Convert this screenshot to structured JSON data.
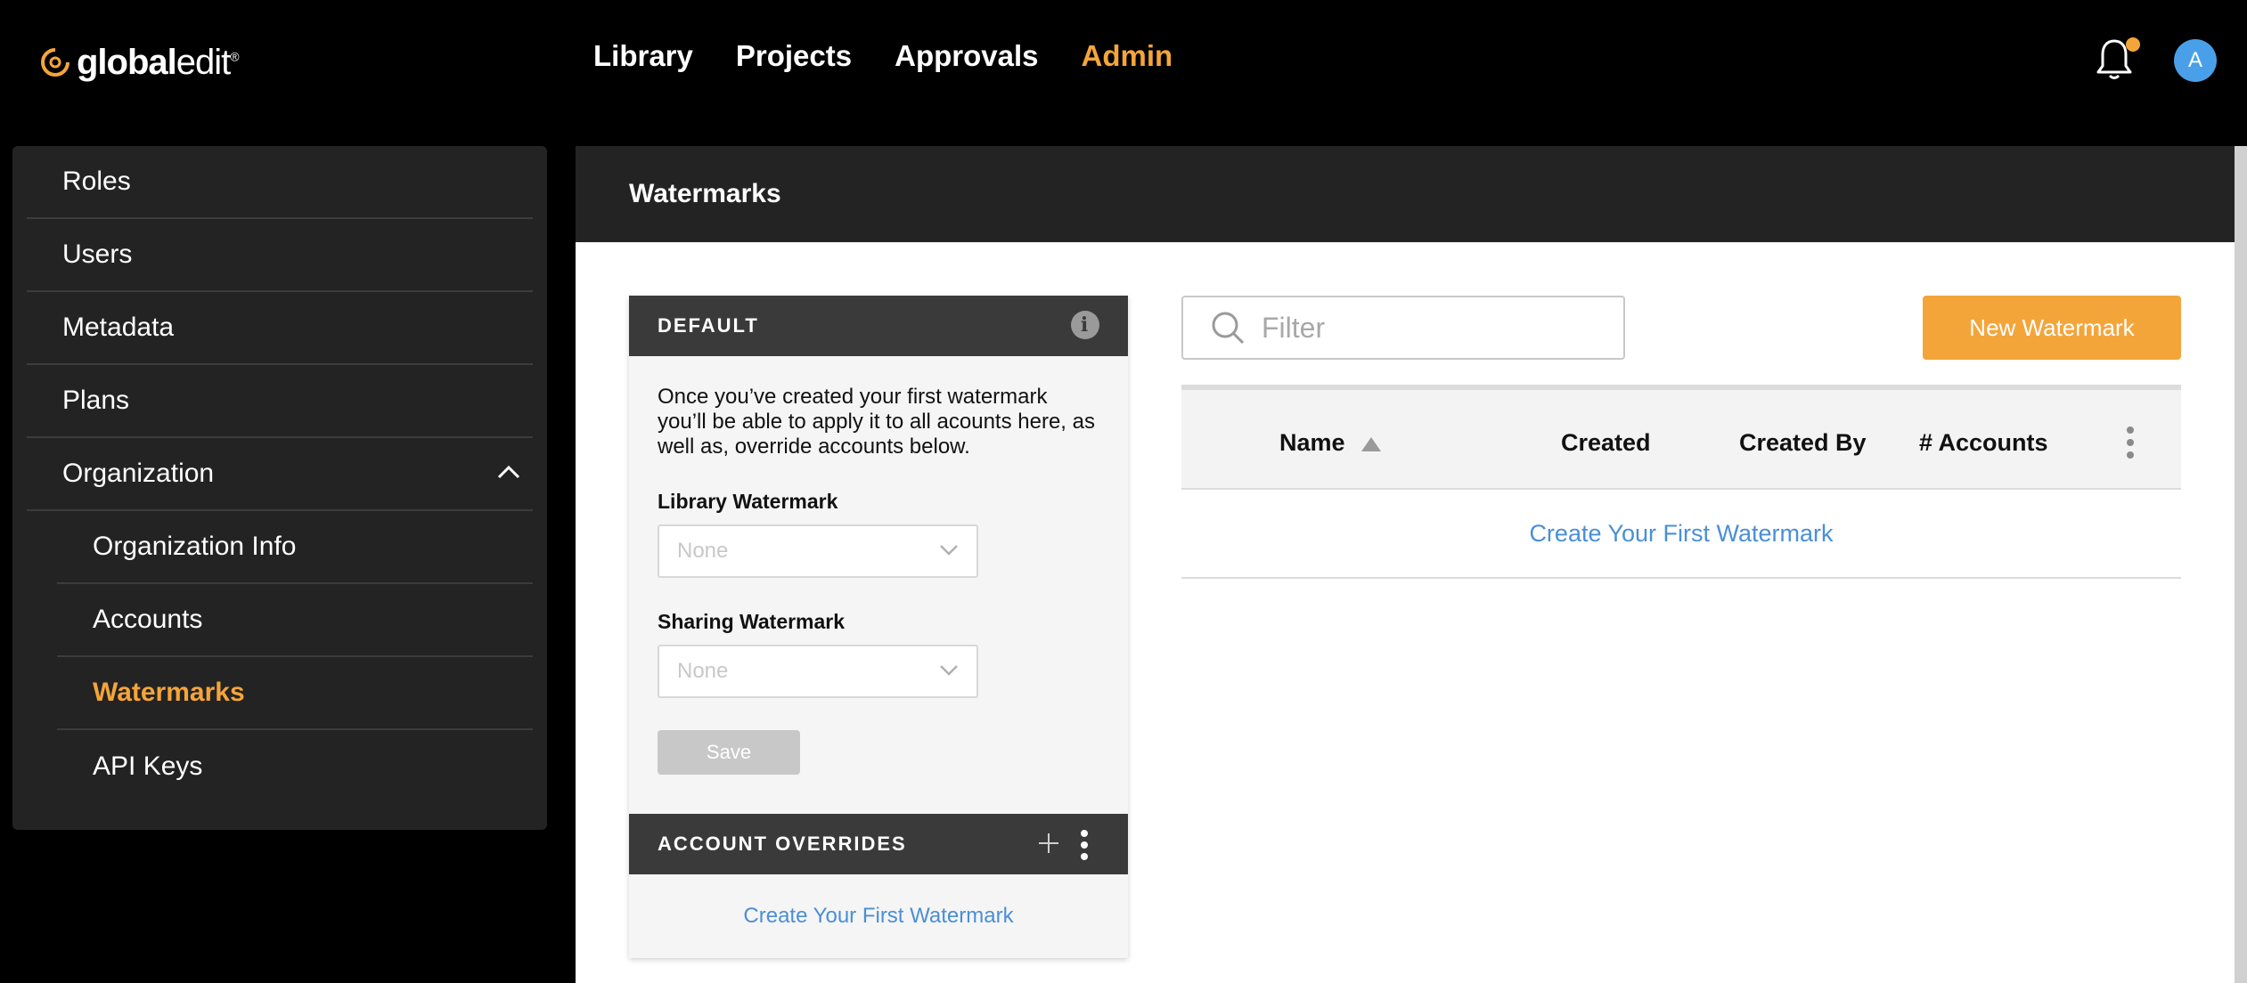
{
  "topbar": {
    "logo_text_bold": "global",
    "logo_text_light": "edit",
    "logo_mark": "®",
    "nav": [
      "Library",
      "Projects",
      "Approvals",
      "Admin"
    ],
    "active_nav": "Admin",
    "avatar_initial": "A",
    "notification_icon": "bell-icon"
  },
  "sidebar": {
    "items": [
      {
        "label": "Roles"
      },
      {
        "label": "Users"
      },
      {
        "label": "Metadata"
      },
      {
        "label": "Plans"
      },
      {
        "label": "Organization"
      },
      {
        "label": "Organization Info"
      },
      {
        "label": "Accounts"
      },
      {
        "label": "Watermarks"
      },
      {
        "label": "API Keys"
      }
    ]
  },
  "main": {
    "title": "Watermarks",
    "default_card": {
      "header": "DEFAULT",
      "description": "Once you’ve created your first watermark you’ll be able to apply it to all acounts here, as well as, override accounts below.",
      "library_label": "Library Watermark",
      "library_value": "None",
      "sharing_label": "Sharing Watermark",
      "sharing_value": "None",
      "save_label": "Save",
      "overrides_header": "ACCOUNT OVERRIDES",
      "overrides_link": "Create Your First Watermark"
    },
    "filter_placeholder": "Filter",
    "new_button": "New Watermark",
    "table": {
      "columns": [
        "Name",
        "Created",
        "Created By",
        "# Accounts"
      ],
      "empty_link": "Create Your First Watermark"
    }
  },
  "colors": {
    "accent": "#f4a53a",
    "link": "#4a8fd6",
    "avatar": "#4aa0e8"
  }
}
